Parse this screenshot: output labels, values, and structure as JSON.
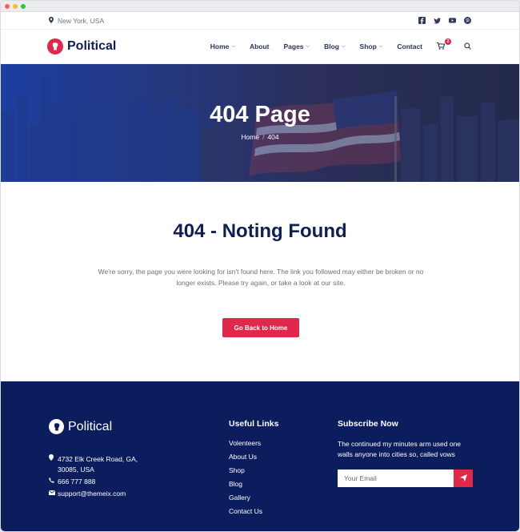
{
  "topbar": {
    "location": "New York, USA"
  },
  "brand": {
    "name": "Political",
    "accent": "#e0294a",
    "navy": "#0b1d5c"
  },
  "nav": {
    "items": [
      {
        "label": "Home",
        "dropdown": true
      },
      {
        "label": "About",
        "dropdown": false
      },
      {
        "label": "Pages",
        "dropdown": true
      },
      {
        "label": "Blog",
        "dropdown": true
      },
      {
        "label": "Shop",
        "dropdown": true
      },
      {
        "label": "Contact",
        "dropdown": false
      }
    ],
    "cart_count": "2"
  },
  "hero": {
    "title": "404 Page",
    "breadcrumb_home": "Home",
    "breadcrumb_sep": "/",
    "breadcrumb_current": "404"
  },
  "main": {
    "title": "404 - Noting Found",
    "text": "We're sorry, the page you were looking for isn't found here. The link you followed may either be broken or no longer exists. Please try again, or take a look at our site.",
    "button": "Go Back to Home"
  },
  "footer": {
    "brand": "Political",
    "address": "4732 Elk Creek Road, GA, 30085, USA",
    "phone": "666 777 888",
    "email": "support@themeix.com",
    "links_title": "Useful Links",
    "links": [
      "Volenteers",
      "About Us",
      "Shop",
      "Blog",
      "Gallery",
      "Contact Us"
    ],
    "subscribe_title": "Subscribe Now",
    "subscribe_text": "The continued my minutes arm used one walls anyone into cities so, called vows",
    "email_placeholder": "Your Email"
  }
}
